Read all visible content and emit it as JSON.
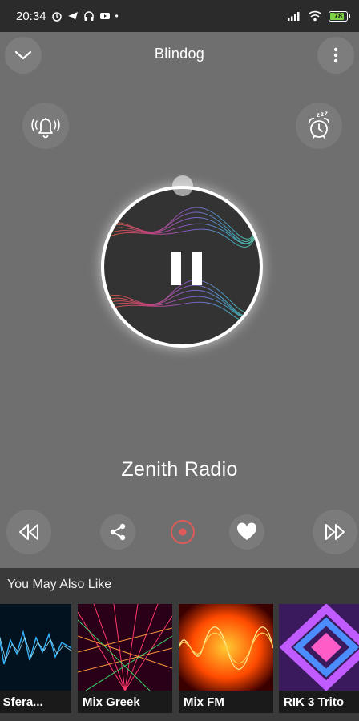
{
  "status_bar": {
    "time": "20:34",
    "battery": "78"
  },
  "header": {
    "title": "Blindog"
  },
  "player": {
    "station_name": "Zenith Radio"
  },
  "recommendations": {
    "title": "You May Also Like",
    "items": [
      {
        "label": "dio Sfera..."
      },
      {
        "label": "Mix Greek"
      },
      {
        "label": "Mix FM"
      },
      {
        "label": "RIK 3 Trito"
      }
    ]
  },
  "colors": {
    "background": "#6f6f6f",
    "status_bar": "#2b2b2b",
    "record_accent": "#e05a5a",
    "battery_fill": "#7cd147"
  }
}
